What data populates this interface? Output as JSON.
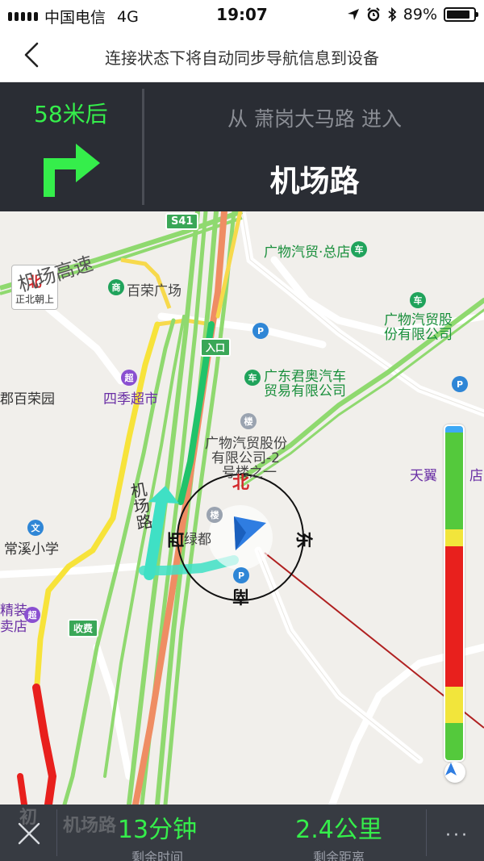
{
  "status_bar": {
    "carrier": "中国电信",
    "network": "4G",
    "time": "19:07",
    "battery": "89%"
  },
  "header": {
    "title": "连接状态下将自动同步导航信息到设备"
  },
  "guidance": {
    "distance": "58米后",
    "from_text": "从 萧岗大马路 进入",
    "road_name": "机场路",
    "maneuver": "turn-right"
  },
  "map": {
    "north_label": "北",
    "north_text": "正北朝上",
    "highway_shield": "S41",
    "entrance_shield": "入口",
    "toll_shield": "收费",
    "compass": {
      "north": "北",
      "south": "南",
      "east": "东",
      "west": "西"
    },
    "labels": {
      "guangwu_zongdian": "广物汽贸·总店",
      "airport_expressway": "机场高速",
      "bairong_plaza": "百荣广场",
      "guangwu_gufen_1": "广物汽贸股",
      "guangwu_gufen_2": "份有限公司",
      "guangdong_junao_1": "广东君奥汽车",
      "guangdong_junao_2": "贸易有限公司",
      "bairong_yuan": "郡百荣园",
      "siji_market": "四季超市",
      "guangwu_2_1": "广物汽贸股份",
      "guangwu_2_2": "有限公司-2",
      "guangwu_2_3": "号楼之一",
      "tianyi": "天翼",
      "tianyi_dian": "店",
      "jichang_road": "机场路",
      "changxi_school": "常溪小学",
      "lvdu": "绿都",
      "deco_1": "精装",
      "deco_2": "卖店",
      "airport_road_bottom": "机场路",
      "chu": "初"
    },
    "traffic_bar_colors": [
      "#3ea9f5",
      "#54c93c",
      "#54c93c",
      "#f2e53b",
      "#e8201d",
      "#e8201d",
      "#f2e53b",
      "#54c93c"
    ],
    "traffic_bar_portions": [
      0.02,
      0.29,
      0.0,
      0.05,
      0.42,
      0.0,
      0.11,
      0.11
    ]
  },
  "bottom_bar": {
    "remaining_time": "13分钟",
    "remaining_time_label": "剩余时间",
    "remaining_distance": "2.4公里",
    "remaining_distance_label": "剩余距离",
    "more_label": "···"
  },
  "colors": {
    "accent_green": "#35ee4b",
    "panel_bg": "#2a2d34",
    "route_cyan": "#3fe0c5"
  }
}
